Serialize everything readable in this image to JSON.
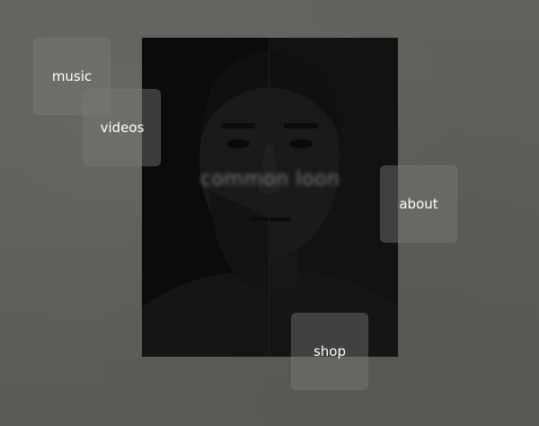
{
  "brand": {
    "name": "common loon"
  },
  "nav": {
    "music": "music",
    "videos": "videos",
    "about": "about",
    "shop": "shop"
  },
  "colors": {
    "background": "#5f5e59",
    "tile": "#787876",
    "portrait": "#0b0b0b",
    "text": "#ffffff"
  }
}
